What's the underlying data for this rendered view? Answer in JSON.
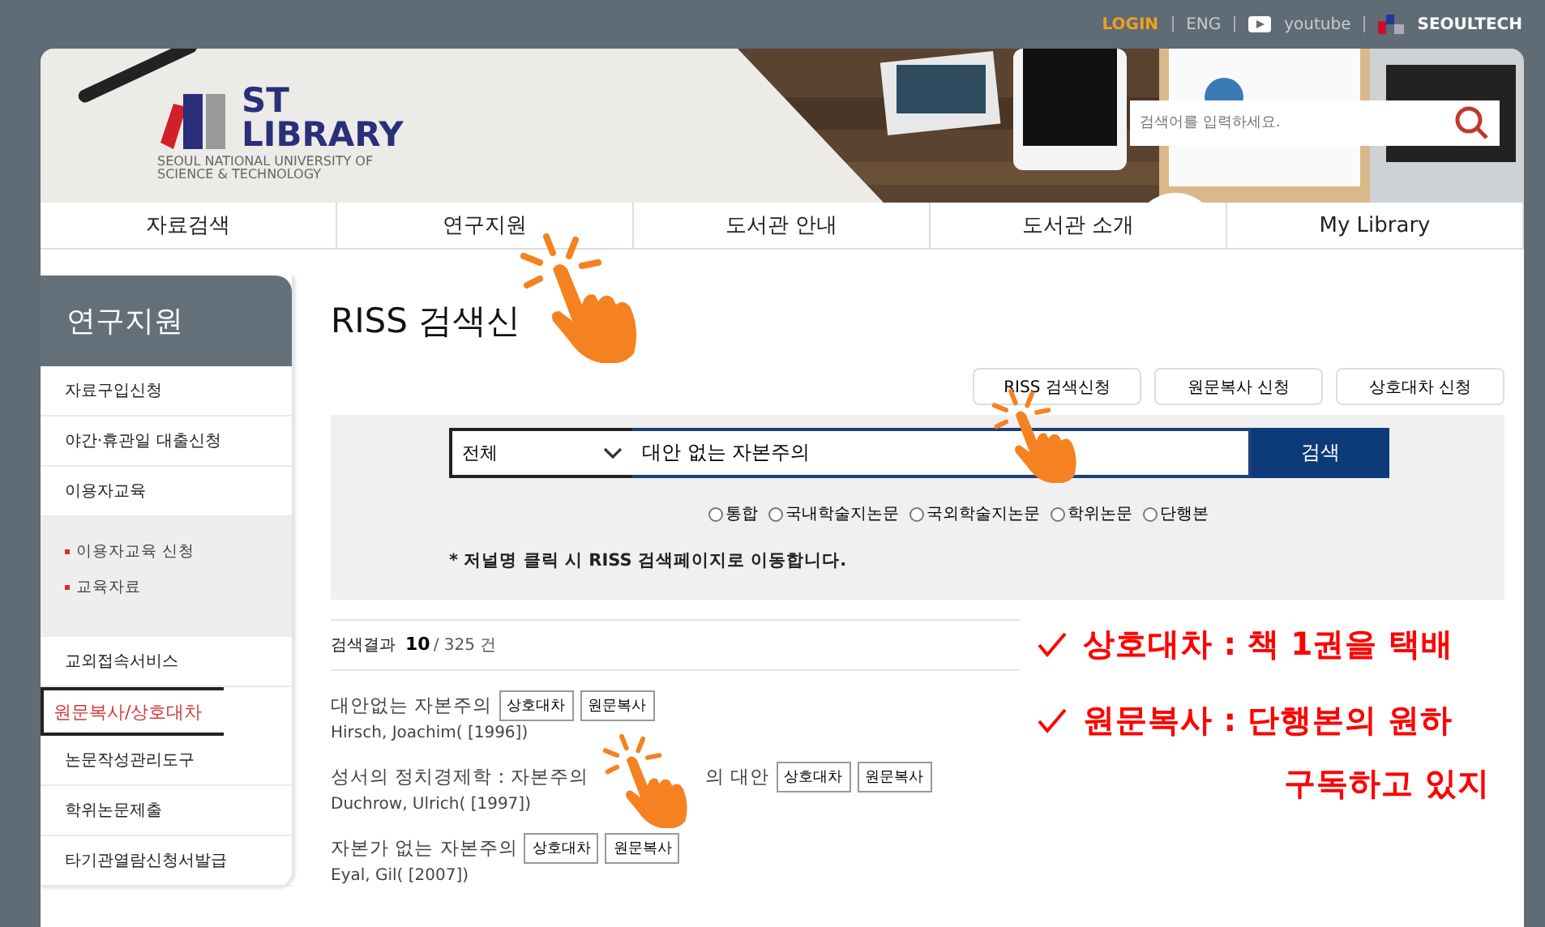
{
  "top_links": [
    {
      "label": "LOGIN",
      "kind": "login"
    },
    {
      "label": "ENG",
      "kind": "text"
    },
    {
      "label": "youtube",
      "kind": "youtube"
    },
    {
      "label": "SEOULTECH",
      "kind": "brand"
    }
  ],
  "logo": {
    "mark": "ST",
    "name": "LIBRARY",
    "subtitle": "SEOUL NATIONAL UNIVERSITY OF SCIENCE & TECHNOLOGY"
  },
  "banner_search": {
    "placeholder": "검색어를 입력하세요."
  },
  "nav": [
    "자료검색",
    "연구지원",
    "도서관 안내",
    "도서관 소개",
    "My Library"
  ],
  "sidebar": {
    "title": "연구지원",
    "items": [
      {
        "label": "자료구입신청",
        "selected": false
      },
      {
        "label": "야간·휴관일 대출신청",
        "selected": false
      },
      {
        "label": "이용자교육",
        "selected": false,
        "expanded": true,
        "children": [
          {
            "label": "이용자교육 신청"
          },
          {
            "label": "교육자료"
          }
        ]
      },
      {
        "label": "교외접속서비스",
        "selected": false
      },
      {
        "label": "원문복사/상호대차",
        "selected": true
      },
      {
        "label": "논문작성관리도구",
        "selected": false
      },
      {
        "label": "학위논문제출",
        "selected": false
      },
      {
        "label": "타기관열람신청서발급",
        "selected": false
      }
    ]
  },
  "page_title": "RISS 검색신",
  "action_buttons": [
    "RISS 검색신청",
    "원문복사 신청",
    "상호대차 신청"
  ],
  "search": {
    "scope": "전체",
    "value": "대안 없는 자본주의",
    "button": "검색"
  },
  "radios": [
    {
      "label": "통합",
      "selected": false
    },
    {
      "label": "국내학술지논문",
      "selected": false
    },
    {
      "label": "국외학술지논문",
      "selected": false
    },
    {
      "label": "학위논문",
      "selected": false
    },
    {
      "label": "단행본",
      "selected": false
    }
  ],
  "note": "* 저널명 클릭 시 RISS 검색페이지로 이동합니다.",
  "results_summary": {
    "label": "검색결과",
    "count": "10",
    "total": "/ 325 건"
  },
  "results": [
    {
      "title": "대안없는 자본주의",
      "tags": [
        "상호대차",
        "원문복사"
      ],
      "author": "Hirsch, Joachim( [1996])"
    },
    {
      "title": "성서의 정치경제학 : 자본주의",
      "title_end": "의 대안",
      "tags": [
        "상호대차",
        "원문복사"
      ],
      "author": "Duchrow, Ulrich( [1997])"
    },
    {
      "title": "자본가 없는 자본주의",
      "tags": [
        "상호대차",
        "원문복사"
      ],
      "author": "Eyal, Gil( [2007])"
    }
  ],
  "annotations": [
    {
      "text": "상호대차 : 책 1권을 택배",
      "check": true
    },
    {
      "text": "원문복사 : 단행본의 원하",
      "check": true
    },
    {
      "text": "구독하고 있지",
      "check": false
    }
  ]
}
